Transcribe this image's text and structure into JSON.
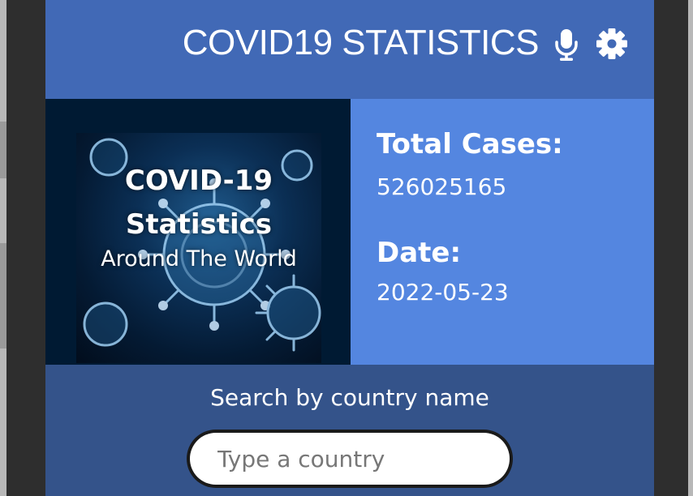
{
  "header": {
    "title": "COVID19 STATISTICS",
    "mic_icon": "microphone-icon",
    "settings_icon": "gear-icon",
    "background": "#4169b6"
  },
  "hero": {
    "title": "COVID-19 Statistics",
    "subtitle": "Around The World"
  },
  "stats": {
    "total_cases_label": "Total Cases:",
    "total_cases_value": "526025165",
    "date_label": "Date:",
    "date_value": "2022-05-23",
    "background": "#5486e0"
  },
  "search": {
    "label": "Search by country name",
    "placeholder": "Type a country",
    "value": ""
  },
  "colors": {
    "screen_bg": "#34538a",
    "hero_bg": "#001a33"
  }
}
